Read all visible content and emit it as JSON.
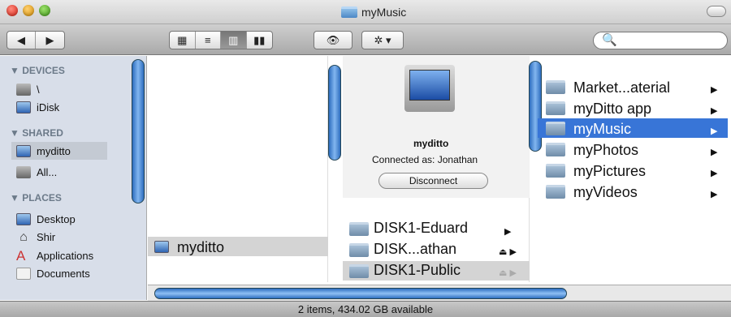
{
  "window": {
    "title": "myMusic"
  },
  "toolbar": {
    "back": "◀",
    "forward": "▶",
    "view_icon": "▦",
    "view_list": "≡",
    "view_column": "▥",
    "view_coverflow": "▮▮",
    "eye": "👁",
    "gear": "✲ ▾",
    "search_placeholder": "🔍"
  },
  "sidebar": {
    "devices": "▼ DEVICES",
    "shared": "▼ SHARED",
    "places": "▼ PLACES",
    "items": [
      {
        "label": "\\"
      },
      {
        "label": "iDisk"
      },
      {
        "label": "myditto"
      },
      {
        "label": "All..."
      },
      {
        "label": "Desktop"
      },
      {
        "label": "Shir"
      },
      {
        "label": "Applications"
      },
      {
        "label": "Documents"
      }
    ]
  },
  "column1": {
    "label": "myditto"
  },
  "preview": {
    "name": "myditto",
    "connected": "Connected as: Jonathan",
    "button": "Disconnect"
  },
  "column2": [
    {
      "label": "DISK1-Eduard"
    },
    {
      "label": "DISK...athan"
    },
    {
      "label": "DISK1-Public"
    }
  ],
  "column3": [
    {
      "label": "Market...aterial"
    },
    {
      "label": "myDitto app"
    },
    {
      "label": "myMusic"
    },
    {
      "label": "myPhotos"
    },
    {
      "label": "myPictures"
    },
    {
      "label": "myVideos"
    }
  ],
  "status": "2 items, 434.02 GB available",
  "colors": {
    "selection": "#3875d7",
    "sidebar": "#d8dee9"
  }
}
